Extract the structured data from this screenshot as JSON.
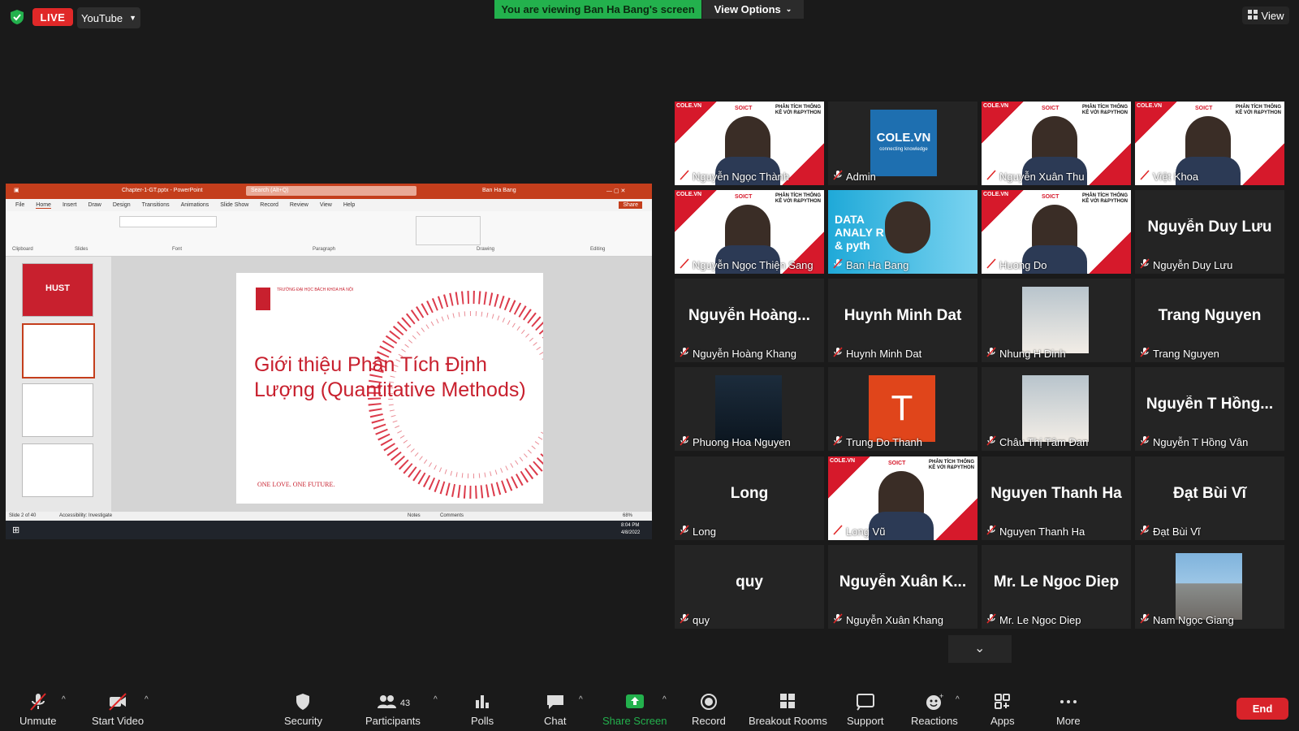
{
  "topbar": {
    "live_label": "LIVE",
    "stream_target": "YouTube",
    "banner": "You are viewing Ban Ha Bang's screen",
    "view_options": "View Options",
    "view": "View"
  },
  "shared": {
    "ppt_file": "Chapter-1-GT.pptx - PowerPoint",
    "ppt_search": "Search (Alt+Q)",
    "ppt_user": "Ban Ha Bang",
    "ppt_share": "Share",
    "ppt_menu": [
      "File",
      "Home",
      "Insert",
      "Draw",
      "Design",
      "Transitions",
      "Animations",
      "Slide Show",
      "Record",
      "Review",
      "View",
      "Help"
    ],
    "ribbon_groups": [
      "Clipboard",
      "Slides",
      "Font",
      "Paragraph",
      "Drawing",
      "Editing"
    ],
    "slide_title": "Giới thiệu Phân Tích Định Lượng (Quantitative Methods)",
    "slide_logo": "TRƯỜNG ĐẠI HỌC BÁCH KHOA HÀ NỘI",
    "slide_footer": "ONE LOVE. ONE FUTURE.",
    "status_left": "Slide 2 of 40",
    "status_access": "Accessibility: Investigate",
    "status_notes": "Notes",
    "status_comments": "Comments",
    "zoom": "68%",
    "clock_time": "8:04 PM",
    "clock_date": "4/8/2022"
  },
  "participants": [
    {
      "name": "Nguyễn Ngọc Thành",
      "kind": "cole"
    },
    {
      "name": "Admin",
      "kind": "admin"
    },
    {
      "name": "Nguyễn Xuân Thu",
      "kind": "cole"
    },
    {
      "name": "Việt Khoa",
      "kind": "cole"
    },
    {
      "name": "Nguyễn Ngọc Thiện Sang",
      "kind": "cole"
    },
    {
      "name": "Ban Ha Bang",
      "kind": "speaker"
    },
    {
      "name": "Huong Do",
      "kind": "cole"
    },
    {
      "name": "Nguyễn Duy Lưu",
      "kind": "text",
      "display": "Nguyễn Duy Lưu"
    },
    {
      "name": "Nguyễn Hoàng Khang",
      "kind": "text",
      "display": "Nguyễn Hoàng..."
    },
    {
      "name": "Huynh Minh Dat",
      "kind": "text",
      "display": "Huynh Minh Dat"
    },
    {
      "name": "Nhung H Dinh",
      "kind": "photo"
    },
    {
      "name": "Trang Nguyen",
      "kind": "text",
      "display": "Trang Nguyen"
    },
    {
      "name": "Phuong Hoa Nguyen",
      "kind": "photo-dark"
    },
    {
      "name": "Trung Do Thanh",
      "kind": "letter",
      "letter": "T"
    },
    {
      "name": "Châu Thị Tâm Đan",
      "kind": "photo"
    },
    {
      "name": "Nguyễn T Hồng Vân",
      "kind": "text",
      "display": "Nguyễn T Hồng..."
    },
    {
      "name": "Long",
      "kind": "text",
      "display": "Long"
    },
    {
      "name": "Long Vũ",
      "kind": "cole"
    },
    {
      "name": "Nguyen Thanh Ha",
      "kind": "text",
      "display": "Nguyen Thanh Ha"
    },
    {
      "name": "Đạt Bùi Vĩ",
      "kind": "text",
      "display": "Đạt Bùi Vĩ"
    },
    {
      "name": "quy",
      "kind": "text",
      "display": "quy"
    },
    {
      "name": "Nguyễn Xuân Khang",
      "kind": "text",
      "display": "Nguyễn Xuân K..."
    },
    {
      "name": "Mr. Le Ngoc Diep",
      "kind": "text",
      "display": "Mr. Le Ngoc Diep"
    },
    {
      "name": "Nam Ngọc Giang",
      "kind": "photo-beach"
    }
  ],
  "cole_brand": "COLE.VN",
  "cole_soict": "SOICT",
  "cole_heading": "PHÂN TÍCH THỐNG KÊ VỚI R&PYTHON",
  "admin_logo": "COLE.VN",
  "admin_tagline": "connecting knowledge",
  "speaker_overlay": "DATA ANALY R & pyth",
  "toolbar": {
    "unmute": "Unmute",
    "start_video": "Start Video",
    "security": "Security",
    "participants": "Participants",
    "participants_count": "43",
    "polls": "Polls",
    "chat": "Chat",
    "share_screen": "Share Screen",
    "record": "Record",
    "breakout": "Breakout Rooms",
    "support": "Support",
    "reactions": "Reactions",
    "apps": "Apps",
    "more": "More",
    "end": "End"
  },
  "colors": {
    "accent_green": "#23b14d",
    "live_red": "#e02828",
    "end_red": "#d8232a",
    "speaker_border": "#f2d21b",
    "ppt_brand": "#c43e1c"
  }
}
